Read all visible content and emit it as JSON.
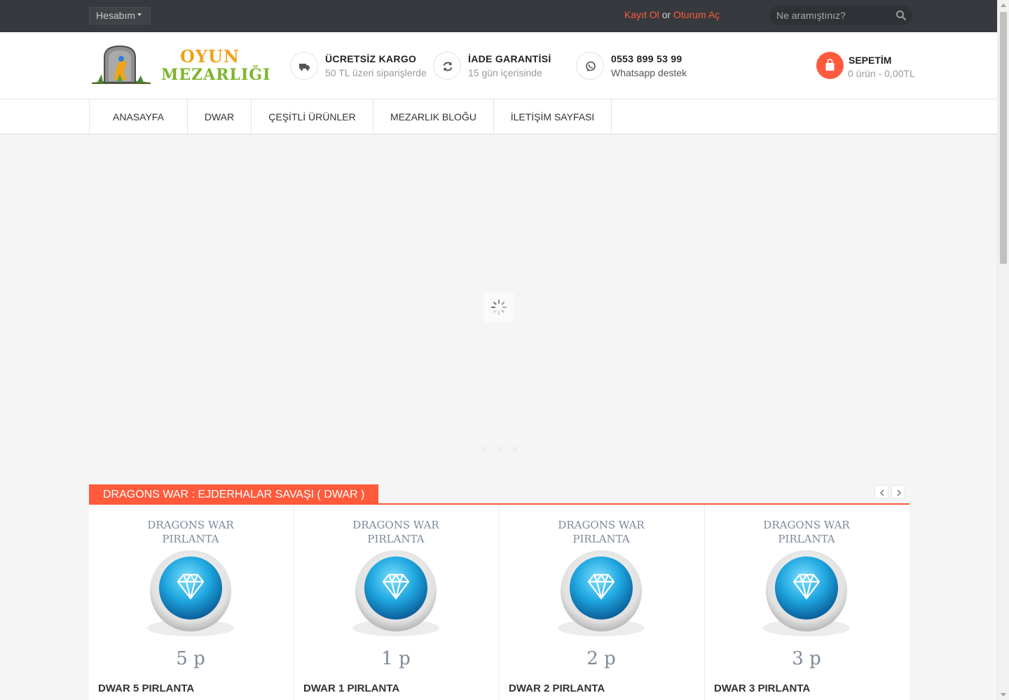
{
  "topbar": {
    "account_label": "Hesabım",
    "register_label": "Kayıt Ol",
    "or_label": "or",
    "login_label": "Oturum Aç",
    "search_placeholder": "Ne aramıştınız?"
  },
  "brand": {
    "line1": "OYUN",
    "line2": "MEZARLIĞI"
  },
  "features": [
    {
      "title": "ÜCRETSİZ KARGO",
      "subtitle": "50 TL üzeri siparişlerde",
      "icon": "truck-icon"
    },
    {
      "title": "İADE GARANTİSİ",
      "subtitle": "15 gün içerisinde",
      "icon": "refresh-icon"
    },
    {
      "title": "0553 899 53 99",
      "subtitle": "Whatsapp destek",
      "icon": "whatsapp-icon"
    }
  ],
  "cart": {
    "title": "SEPETİM",
    "summary": "0 ürün - 0,00TL",
    "icon": "shopping-bag-icon"
  },
  "nav": [
    {
      "label": "ANASAYFA"
    },
    {
      "label": "DWAR"
    },
    {
      "label": "ÇEŞİTLİ ÜRÜNLER"
    },
    {
      "label": "MEZARLIK BLOĞU"
    },
    {
      "label": "İLETİŞİM SAYFASI"
    }
  ],
  "products_section": {
    "title": "DRAGONS WAR : EJDERHALAR SAVAŞI ( DWAR )",
    "items": [
      {
        "name": "DWAR 5 PIRLANTA",
        "img_line1": "DRAGONS WAR",
        "img_line2": "PIRLANTA",
        "img_amount": "5 p"
      },
      {
        "name": "DWAR 1 PIRLANTA",
        "img_line1": "DRAGONS WAR",
        "img_line2": "PIRLANTA",
        "img_amount": "1 p"
      },
      {
        "name": "DWAR 2 PIRLANTA",
        "img_line1": "DRAGONS WAR",
        "img_line2": "PIRLANTA",
        "img_amount": "2 p"
      },
      {
        "name": "DWAR 3 PIRLANTA",
        "img_line1": "DRAGONS WAR",
        "img_line2": "PIRLANTA",
        "img_amount": "3 p"
      }
    ]
  },
  "colors": {
    "accent": "#ff5a3c",
    "topbar": "#363a3e",
    "gem": "#1fa7e0"
  }
}
